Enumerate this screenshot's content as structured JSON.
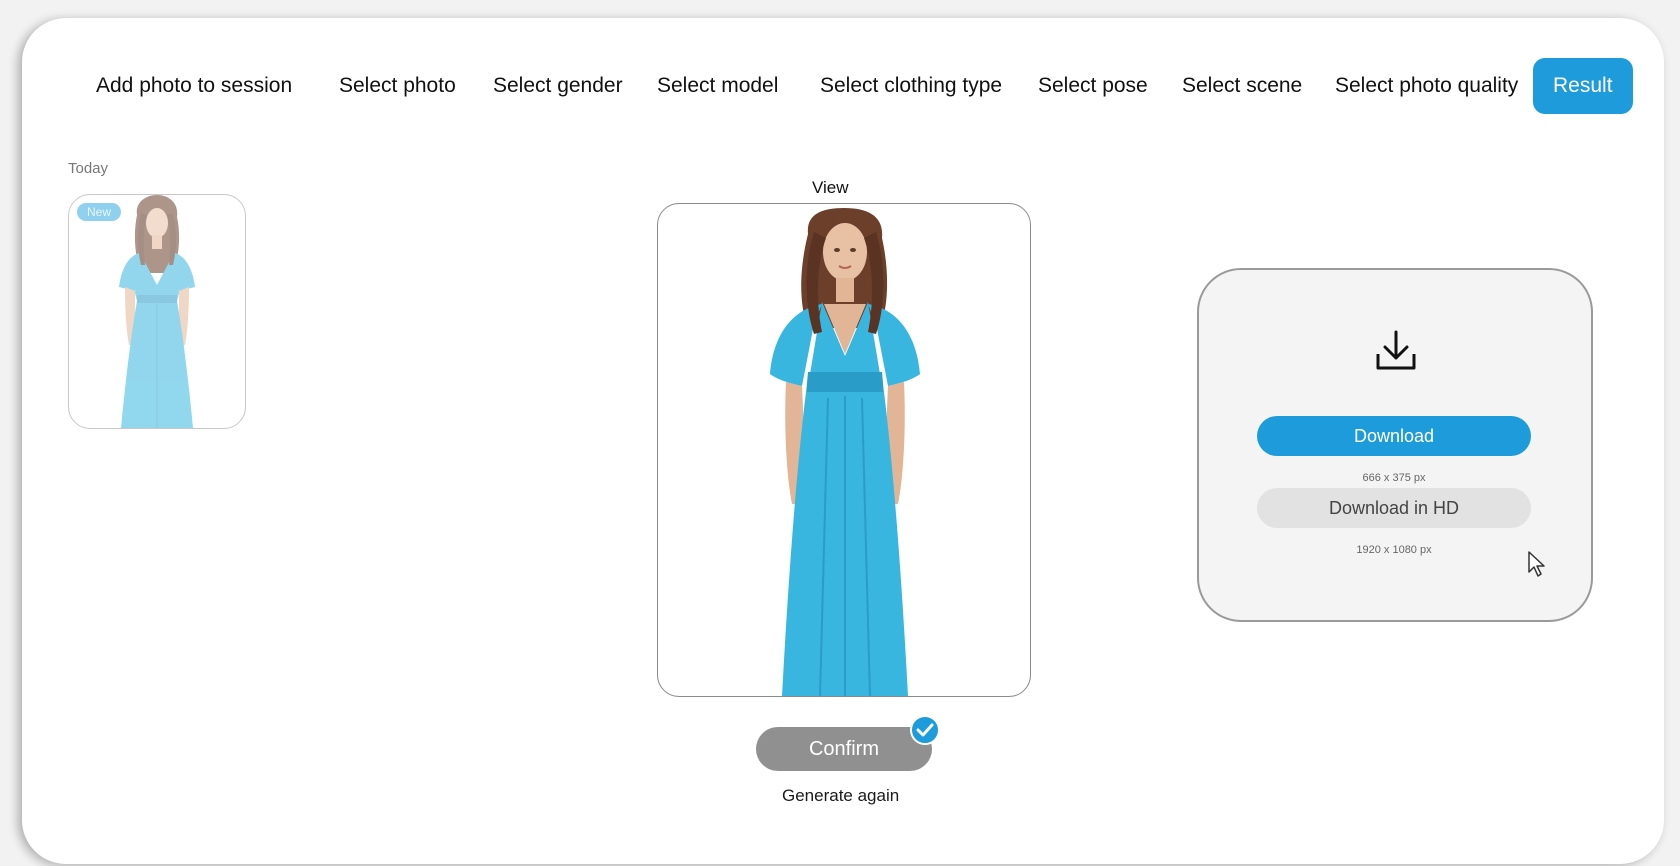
{
  "nav": {
    "items": [
      {
        "label": "Add photo to session"
      },
      {
        "label": "Select photo"
      },
      {
        "label": "Select gender"
      },
      {
        "label": "Select model"
      },
      {
        "label": "Select clothing type"
      },
      {
        "label": "Select pose"
      },
      {
        "label": "Select scene"
      },
      {
        "label": "Select photo quality"
      },
      {
        "label": "Result"
      }
    ],
    "active_index": 8
  },
  "history": {
    "group_label": "Today",
    "items": [
      {
        "badge": "New",
        "icon": "model-photo-thumbnail"
      }
    ]
  },
  "view": {
    "label": "View",
    "icon": "model-photo-preview"
  },
  "actions": {
    "confirm_label": "Confirm",
    "generate_again_label": "Generate again"
  },
  "download": {
    "icon": "download-icon",
    "primary_label": "Download",
    "primary_size": "666 x 375 px",
    "hd_label": "Download in HD",
    "hd_size": "1920 x 1080 px"
  },
  "colors": {
    "accent": "#1e9bdb",
    "confirm_bg": "#909090",
    "dress": "#38b6e0",
    "hd_button_bg": "#e2e2e2"
  }
}
